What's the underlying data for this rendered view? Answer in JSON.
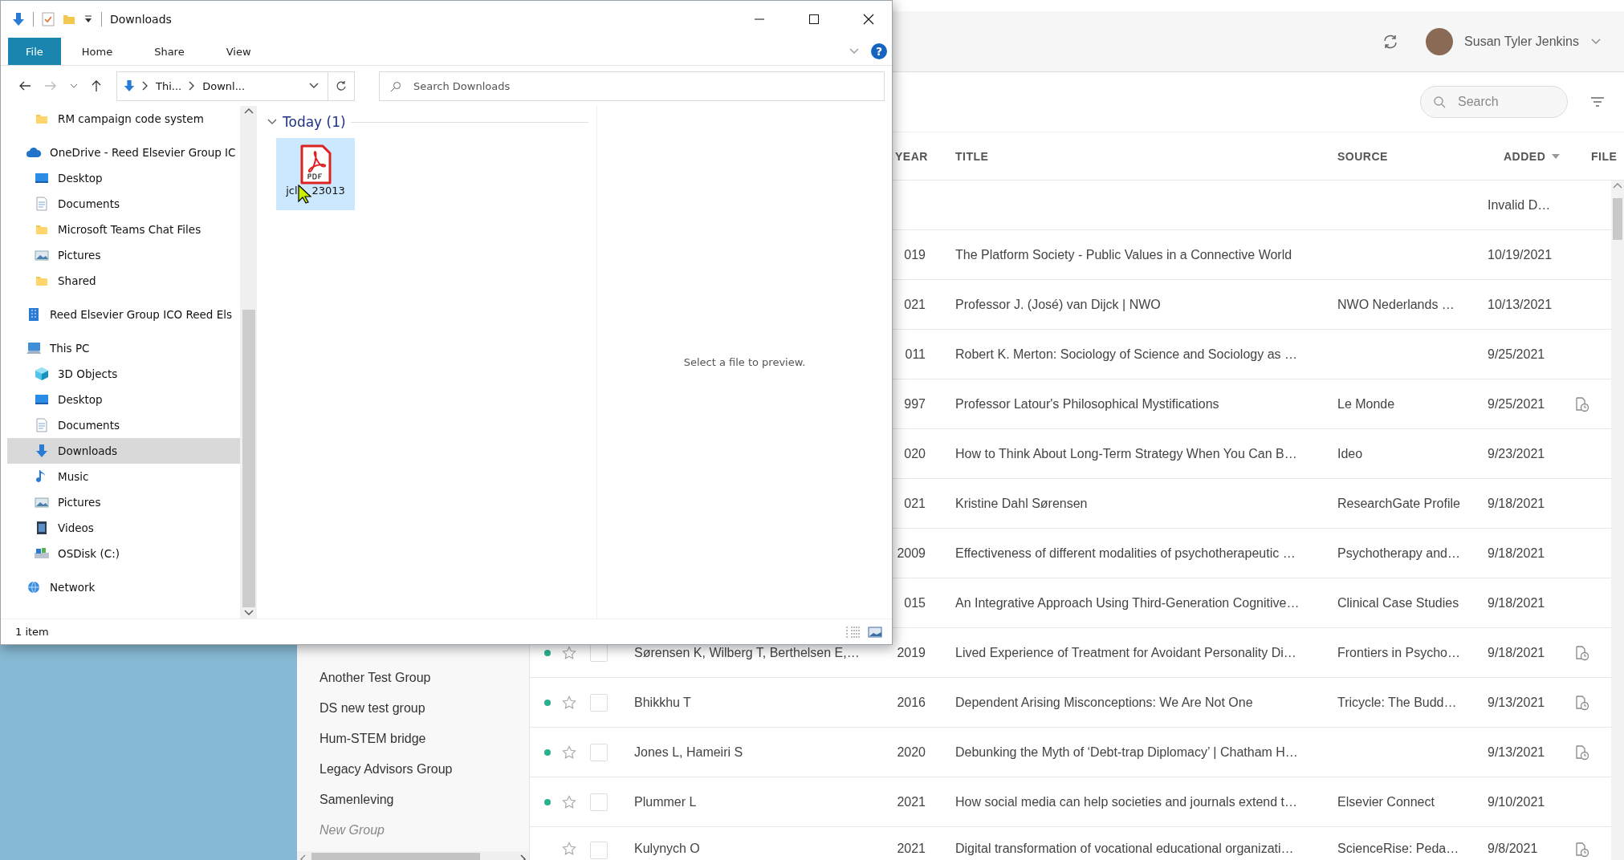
{
  "app": {
    "user_name": "Susan Tyler Jenkins",
    "search": {
      "placeholder": "Search"
    },
    "groups": [
      {
        "label": "Another Test Group",
        "kind": "group"
      },
      {
        "label": "DS new test group",
        "kind": "group"
      },
      {
        "label": "Hum-STEM bridge",
        "kind": "group"
      },
      {
        "label": "Legacy Advisors Group",
        "kind": "group"
      },
      {
        "label": "Samenleving",
        "kind": "group"
      },
      {
        "label": "New Group",
        "kind": "new"
      }
    ],
    "table": {
      "columns": [
        {
          "label": "YEAR",
          "sorted": false
        },
        {
          "label": "TITLE",
          "sorted": false
        },
        {
          "label": "SOURCE",
          "sorted": false
        },
        {
          "label": "ADDED",
          "sorted": true
        },
        {
          "label": "FILE",
          "sorted": false
        }
      ],
      "rows": [
        {
          "added": "Invalid D…",
          "has_file": false
        },
        {
          "year": "019",
          "title": "The Platform Society - Public Values in a Connective World",
          "added": "10/19/2021",
          "has_file": false
        },
        {
          "year": "021",
          "title": "Professor J. (José) van Dijck | NWO",
          "source": "NWO Nederlands …",
          "added": "10/13/2021",
          "has_file": false
        },
        {
          "year": "011",
          "title": "Robert K. Merton: Sociology of Science and Sociology as …",
          "added": "9/25/2021",
          "has_file": false
        },
        {
          "year": "997",
          "title": "Professor Latour's Philosophical Mystifications",
          "source": "Le Monde",
          "added": "9/25/2021",
          "has_file": true
        },
        {
          "year": "020",
          "title": "How to Think About Long-Term Strategy When You Can B…",
          "source": "Ideo",
          "added": "9/23/2021",
          "has_file": false
        },
        {
          "year": "021",
          "title": "Kristine Dahl Sørensen",
          "source": "ResearchGate Profile",
          "added": "9/18/2021",
          "has_file": false
        },
        {
          "year": "2009",
          "title": "Effectiveness of different modalities of psychotherapeutic …",
          "source": "Psychotherapy and…",
          "added": "9/18/2021",
          "has_file": false
        },
        {
          "year": "015",
          "title": "An Integrative Approach Using Third-Generation Cognitive…",
          "source": "Clinical Case Studies",
          "added": "9/18/2021",
          "has_file": false
        },
        {
          "unread": true,
          "starred": false,
          "checked": false,
          "authors": "Sørensen K, Wilberg T, Berthelsen E,…",
          "year": "2019",
          "title": "Lived Experience of Treatment for Avoidant Personality Di…",
          "source": "Frontiers in Psycho…",
          "added": "9/18/2021",
          "has_file": true
        },
        {
          "unread": true,
          "starred": false,
          "checked": false,
          "authors": "Bhikkhu T",
          "year": "2016",
          "title": "Dependent Arising Misconceptions: We Are Not One",
          "source": "Tricycle: The Budd…",
          "added": "9/13/2021",
          "has_file": true
        },
        {
          "unread": true,
          "starred": false,
          "checked": false,
          "authors": "Jones L, Hameiri S",
          "year": "2020",
          "title": "Debunking the Myth of ‘Debt-trap Diplomacy’ | Chatham H…",
          "added": "9/13/2021",
          "has_file": true
        },
        {
          "unread": true,
          "starred": false,
          "checked": false,
          "authors": "Plummer L",
          "year": "2021",
          "title": "How social media can help societies and journals extend t…",
          "source": "Elsevier Connect",
          "added": "9/10/2021",
          "has_file": false
        },
        {
          "unread": false,
          "starred": false,
          "checked": false,
          "authors": "Kulynych O",
          "year": "2021",
          "title": "Digital transformation of vocational educational organizati…",
          "source": "ScienceRise: Peda…",
          "added": "9/8/2021",
          "has_file": true
        }
      ]
    }
  },
  "explorer": {
    "title": "Downloads",
    "ribbon_tabs": [
      {
        "label": "File",
        "kind": "file"
      },
      {
        "label": "Home",
        "kind": "tab"
      },
      {
        "label": "Share",
        "kind": "tab"
      },
      {
        "label": "View",
        "kind": "tab"
      }
    ],
    "help_label": "?",
    "address_segments": [
      "Thi...",
      "Downl..."
    ],
    "search": {
      "placeholder": "Search Downloads"
    },
    "quick_access_tail": [
      {
        "label": "RM campaign code system",
        "kind": "folder",
        "selected": false
      }
    ],
    "nav_tree": [
      {
        "label": "OneDrive - Reed Elsevier Group IC",
        "kind": "cloud",
        "selected": false,
        "children": [
          {
            "label": "Desktop",
            "kind": "desktop",
            "selected": false
          },
          {
            "label": "Documents",
            "kind": "documents",
            "selected": false
          },
          {
            "label": "Microsoft Teams Chat Files",
            "kind": "folder",
            "selected": false
          },
          {
            "label": "Pictures",
            "kind": "pictures",
            "selected": false
          },
          {
            "label": "Shared",
            "kind": "folder",
            "selected": false
          }
        ]
      },
      {
        "label": "Reed Elsevier Group ICO Reed Els",
        "kind": "building",
        "selected": false
      },
      {
        "label": "This PC",
        "kind": "pc",
        "selected": false,
        "children": [
          {
            "label": "3D Objects",
            "kind": "cube",
            "selected": false
          },
          {
            "label": "Desktop",
            "kind": "desktop",
            "selected": false
          },
          {
            "label": "Documents",
            "kind": "documents",
            "selected": false
          },
          {
            "label": "Downloads",
            "kind": "download",
            "selected": true
          },
          {
            "label": "Music",
            "kind": "music",
            "selected": false
          },
          {
            "label": "Pictures",
            "kind": "pictures",
            "selected": false
          },
          {
            "label": "Videos",
            "kind": "videos",
            "selected": false
          },
          {
            "label": "OSDisk (C:)",
            "kind": "disk",
            "selected": false
          }
        ]
      },
      {
        "label": "Network",
        "kind": "network",
        "selected": false
      }
    ],
    "file_groups": [
      {
        "label": "Today (1)",
        "expanded": true,
        "files": [
          {
            "name_start": "jcl",
            "name_end": "23013",
            "kind": "pdf",
            "selected": true
          }
        ]
      }
    ],
    "preview_message": "Select a file to preview.",
    "status": "1 item"
  }
}
